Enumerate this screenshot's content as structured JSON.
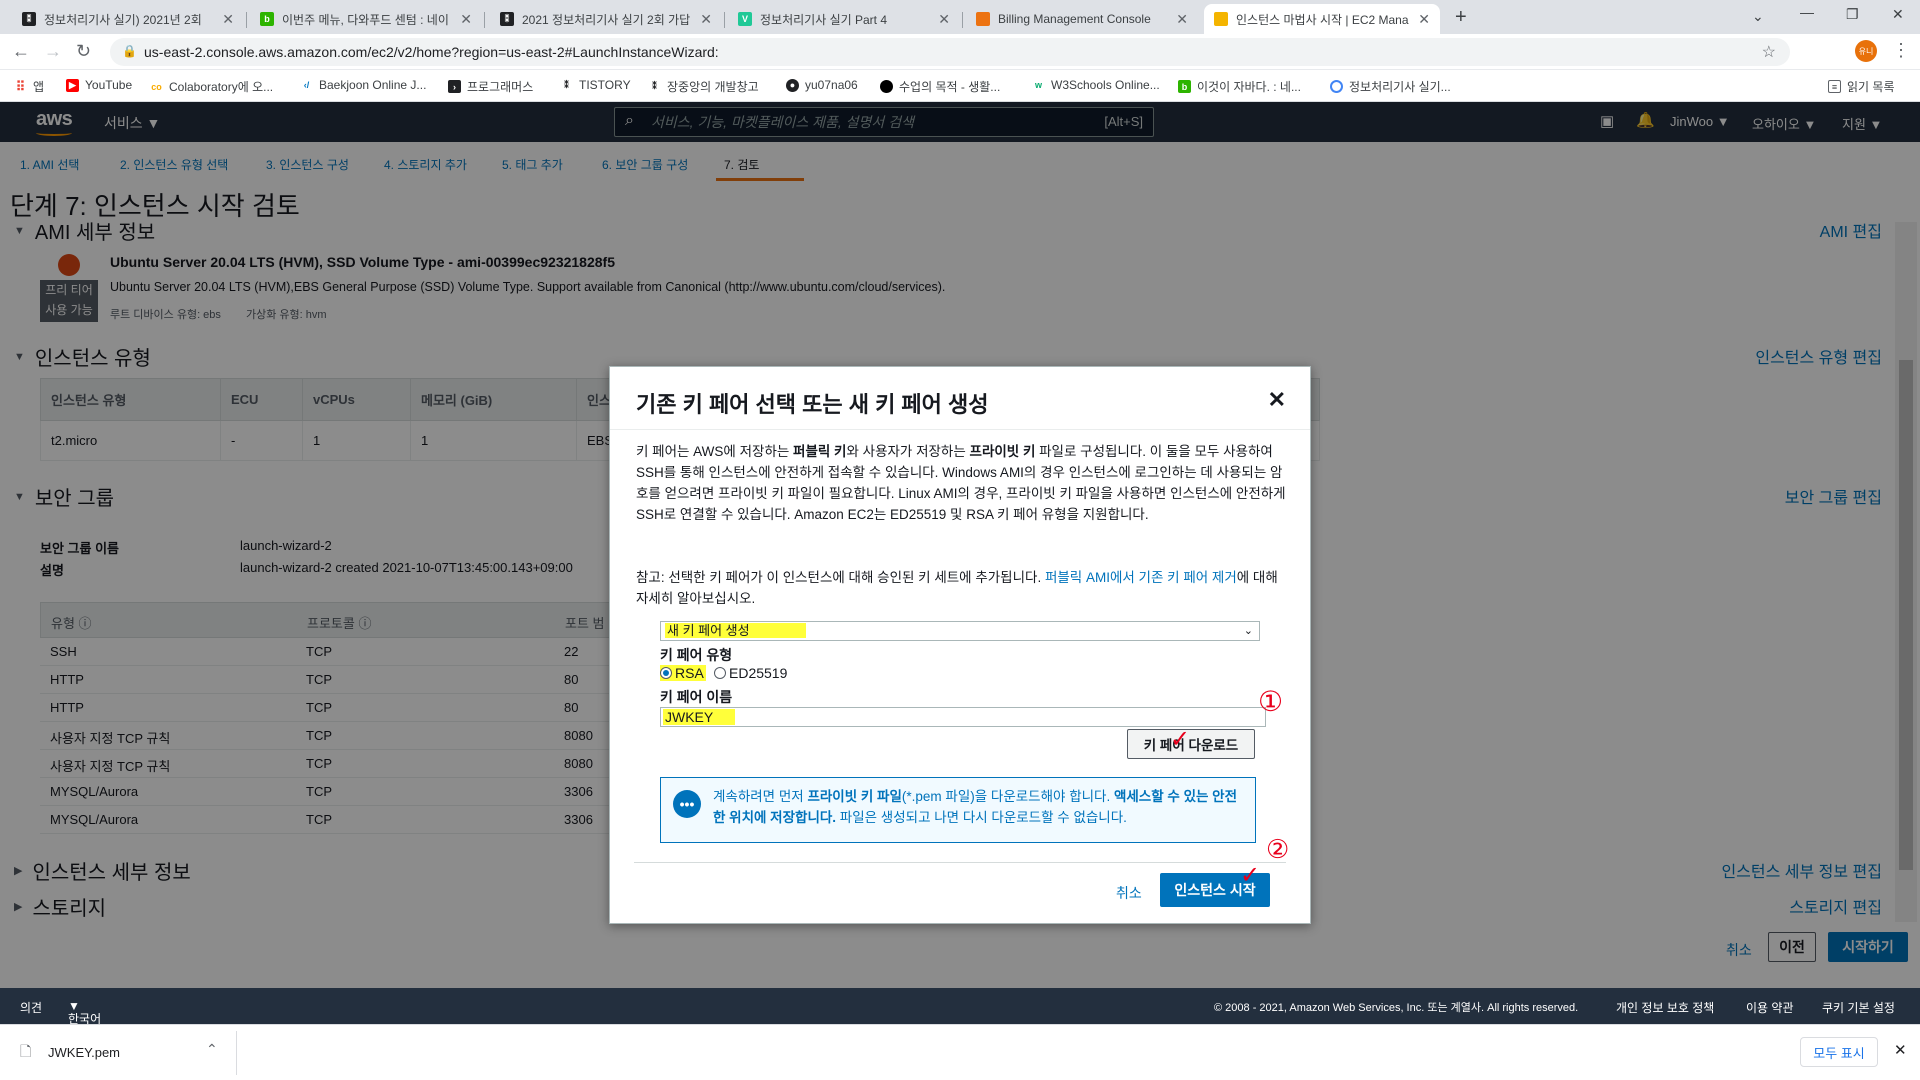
{
  "browser": {
    "tabs": [
      {
        "title": "정보처리기사 실기) 2021년 2회",
        "color": "#202124",
        "glyph": "⁑"
      },
      {
        "title": "이번주 메뉴, 다와푸드 센텀 : 네이",
        "color": "#2db400",
        "glyph": "b"
      },
      {
        "title": "2021 정보처리기사 실기 2회 가답",
        "color": "#202124",
        "glyph": "⁑"
      },
      {
        "title": "정보처리기사 실기 Part 4",
        "color": "#20c997",
        "glyph": "V"
      },
      {
        "title": "Billing Management Console",
        "color": "#ec7211",
        "glyph": "■"
      },
      {
        "title": "인스턴스 마법사 시작 | EC2 Mana",
        "color": "#f4b400",
        "glyph": "■"
      }
    ],
    "url": "us-east-2.console.aws.amazon.com/ec2/v2/home?region=us-east-2#LaunchInstanceWizard:",
    "profile_initials": "유니",
    "bookmarks": [
      {
        "label": "앱",
        "color": "#ea4335",
        "glyph": "⠿"
      },
      {
        "label": "YouTube",
        "color": "#ff0000",
        "glyph": "▶"
      },
      {
        "label": "Colaboratory에 오...",
        "color": "#f9ab00",
        "glyph": "co"
      },
      {
        "label": "Baekjoon Online J...",
        "color": "#0076c0",
        "glyph": "<"
      },
      {
        "label": "프로그래머스",
        "color": "#202124",
        "glyph": "▰"
      },
      {
        "label": "TISTORY",
        "color": "#202124",
        "glyph": "⁑"
      },
      {
        "label": "장중앙의 개발창고",
        "color": "#202124",
        "glyph": "⁑"
      },
      {
        "label": "yu07na06",
        "color": "#202124",
        "glyph": "●"
      },
      {
        "label": "수업의 목적 - 생활...",
        "color": "#000000",
        "glyph": "●"
      },
      {
        "label": "W3Schools Online...",
        "color": "#04aa6d",
        "glyph": "w"
      },
      {
        "label": "이것이 자바다. : 네...",
        "color": "#2db400",
        "glyph": "b"
      },
      {
        "label": "정보처리기사 실기...",
        "color": "#4285f4",
        "glyph": "Q"
      }
    ],
    "reading_list": "읽기 목록"
  },
  "aws_header": {
    "logo": "aws",
    "services": "서비스",
    "search_placeholder": "서비스, 기능, 마켓플레이스 제품, 설명서 검색",
    "search_shortcut": "[Alt+S]",
    "user": "JinWoo",
    "region": "오하이오",
    "support": "지원"
  },
  "wizard_steps": [
    "1. AMI 선택",
    "2. 인스턴스 유형 선택",
    "3. 인스턴스 구성",
    "4. 스토리지 추가",
    "5. 태그 추가",
    "6. 보안 그룹 구성",
    "7. 검토"
  ],
  "page": {
    "title": "단계 7: 인스턴스 시작 검토",
    "ami": {
      "heading": "AMI 세부 정보",
      "edit": "AMI 편집",
      "name": "Ubuntu Server 20.04 LTS (HVM), SSD Volume Type - ami-00399ec92321828f5",
      "description": "Ubuntu Server 20.04 LTS (HVM),EBS General Purpose (SSD) Volume Type. Support available from Canonical (http://www.ubuntu.com/cloud/services).",
      "free_tier_1": "프리 티어",
      "free_tier_2": "사용 가능",
      "root_device": "루트 디바이스 유형: ebs",
      "virtualization": "가상화 유형: hvm"
    },
    "instance_type": {
      "heading": "인스턴스 유형",
      "edit": "인스턴스 유형 편집",
      "columns": [
        "인스턴스 유형",
        "ECU",
        "vCPUs",
        "메모리 (GiB)",
        "인스"
      ],
      "row": [
        "t2.micro",
        "-",
        "1",
        "1",
        "EBS"
      ]
    },
    "security_group": {
      "heading": "보안 그룹",
      "edit": "보안 그룹 편집",
      "name_label": "보안 그룹 이름",
      "name_value": "launch-wizard-2",
      "desc_label": "설명",
      "desc_value": "launch-wizard-2 created 2021-10-07T13:45:00.143+09:00",
      "columns": [
        "유형",
        "프로토콜",
        "포트 범"
      ],
      "rules": [
        [
          "SSH",
          "TCP",
          "22"
        ],
        [
          "HTTP",
          "TCP",
          "80"
        ],
        [
          "HTTP",
          "TCP",
          "80"
        ],
        [
          "사용자 지정 TCP 규칙",
          "TCP",
          "8080"
        ],
        [
          "사용자 지정 TCP 규칙",
          "TCP",
          "8080"
        ],
        [
          "MYSQL/Aurora",
          "TCP",
          "3306"
        ],
        [
          "MYSQL/Aurora",
          "TCP",
          "3306"
        ]
      ]
    },
    "instance_details": {
      "heading": "인스턴스 세부 정보",
      "edit": "인스턴스 세부 정보 편집"
    },
    "storage": {
      "heading": "스토리지",
      "edit": "스토리지 편집"
    },
    "buttons": {
      "cancel": "취소",
      "prev": "이전",
      "launch": "시작하기"
    }
  },
  "modal": {
    "title": "기존 키 페어 선택 또는 새 키 페어 생성",
    "para1": {
      "a": "키 페어는 AWS에 저장하는 ",
      "b": "퍼블릭 키",
      "c": "와 사용자가 저장하는 ",
      "d": "프라이빗 키",
      "e": " 파일로 구성됩니다. 이 둘을 모두 사용하여 SSH를 통해 인스턴스에 안전하게 접속할 수 있습니다. Windows AMI의 경우 인스턴스에 로그인하는 데 사용되는 암호를 얻으려면 프라이빗 키 파일이 필요합니다. Linux AMI의 경우, 프라이빗 키 파일을 사용하면 인스턴스에 안전하게 SSH로 연결할 수 있습니다. Amazon EC2는 ED25519 및 RSA 키 페어 유형을 지원합니다."
    },
    "para2": {
      "a": "참고: 선택한 키 페어가 이 인스턴스에 대해 승인된 키 세트에 추가됩니다. ",
      "link": "퍼블릭 AMI에서 기존 키 페어 제거",
      "b": "에 대해 자세히 알아보십시오."
    },
    "select_value": "새 키 페어 생성",
    "key_type_label": "키 페어 유형",
    "rsa": "RSA",
    "ed25519": "ED25519",
    "key_name_label": "키 페어 이름",
    "key_name_value": "JWKEY",
    "download_button": "키 페어 다운로드",
    "info": {
      "a": "계속하려면 먼저 ",
      "b": "프라이빗 키 파일",
      "c": "(*.pem 파일)을 다운로드해야 합니다. ",
      "d": "액세스할 수 있는 안전한 위치에 저장합니다.",
      "e": " 파일은 생성되고 나면 다시 다운로드할 수 없습니다."
    },
    "cancel": "취소",
    "launch": "인스턴스 시작",
    "annotation_1": "①",
    "annotation_2": "②"
  },
  "footer": {
    "feedback": "의견",
    "language": "한국어",
    "copyright": "© 2008 - 2021, Amazon Web Services, Inc. 또는 계열사. All rights reserved.",
    "privacy": "개인 정보 보호 정책",
    "terms": "이용 약관",
    "cookies": "쿠키 기본 설정"
  },
  "download_shelf": {
    "file": "JWKEY.pem",
    "show_all": "모두 표시"
  }
}
